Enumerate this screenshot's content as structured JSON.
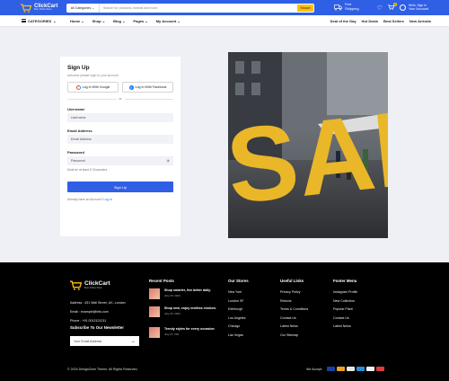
{
  "header": {
    "brand": "ClickCart",
    "tagline": "Best Online Store",
    "search": {
      "category": "All Categories",
      "placeholder": "Search for products, brands and more",
      "button": "Search"
    },
    "shipping": {
      "line1": "Free",
      "line2": "Shipping"
    },
    "cart_count": "0",
    "account": {
      "line1": "Hello, Sign In",
      "line2": "Your Account"
    }
  },
  "nav": {
    "categories": "CATEGORIES",
    "menu": [
      "Home",
      "Shop",
      "Blog",
      "Pages",
      "My Account"
    ],
    "right": [
      "Deal of the Day",
      "Hot Deals",
      "Best Sellers",
      "New Arrivals"
    ]
  },
  "signup": {
    "title": "Sign Up",
    "welcome": "welcome please login to your account",
    "google": "Log In With Google",
    "facebook": "Log In With Facebook",
    "or": "or",
    "username_label": "Username",
    "username_placeholder": "Username",
    "email_label": "Email Address",
    "email_placeholder": "Email Address",
    "password_label": "Password",
    "password_placeholder": "Password",
    "hint": "Must be at least 8 Characters",
    "button": "Sign Up",
    "already": "Already have an Account?",
    "login_link": "Log In"
  },
  "promo": {
    "text": "SALE"
  },
  "footer": {
    "brand": "ClickCart",
    "tagline": "Best Online Store",
    "address": "Address : 431 Wall Street, UK, London",
    "email": "Email : example@info.com",
    "phone": "Phone : +91 0012121211",
    "newsletter_title": "Subscribe To Our Newsletter",
    "newsletter_placeholder": "Your Email Address",
    "recent_posts_title": "Recent Posts",
    "posts": [
      {
        "title": "Shop smarter, live better daily.",
        "date": "July 25, 2024"
      },
      {
        "title": "Shop new, enjoy endless choices.",
        "date": "July 25, 2024"
      },
      {
        "title": "Trendy styles for every occasion",
        "date": "July 27, 204"
      }
    ],
    "stores_title": "Our Stores",
    "stores": [
      "New York",
      "London SF",
      "Edinburgh",
      "Los Angeles",
      "Chicago",
      "Las Vegas"
    ],
    "useful_title": "Useful Links",
    "useful": [
      "Privacy Policy",
      "Returns",
      "Terms & Conditions",
      "Contact Us",
      "Latest News",
      "Our Sitemap"
    ],
    "footer_menu_title": "Footer Menu",
    "footer_menu": [
      "Instagram Profile",
      "New Collection",
      "Popular Plant",
      "Contact Us",
      "Latest News"
    ],
    "copyright": "© 2024 DesignZone Theme. All Rights Reserved.",
    "accept_label": "We Accept:"
  },
  "colors": {
    "primary": "#2f5fe5",
    "accent": "#ffc107",
    "footer_bg": "#000000"
  }
}
